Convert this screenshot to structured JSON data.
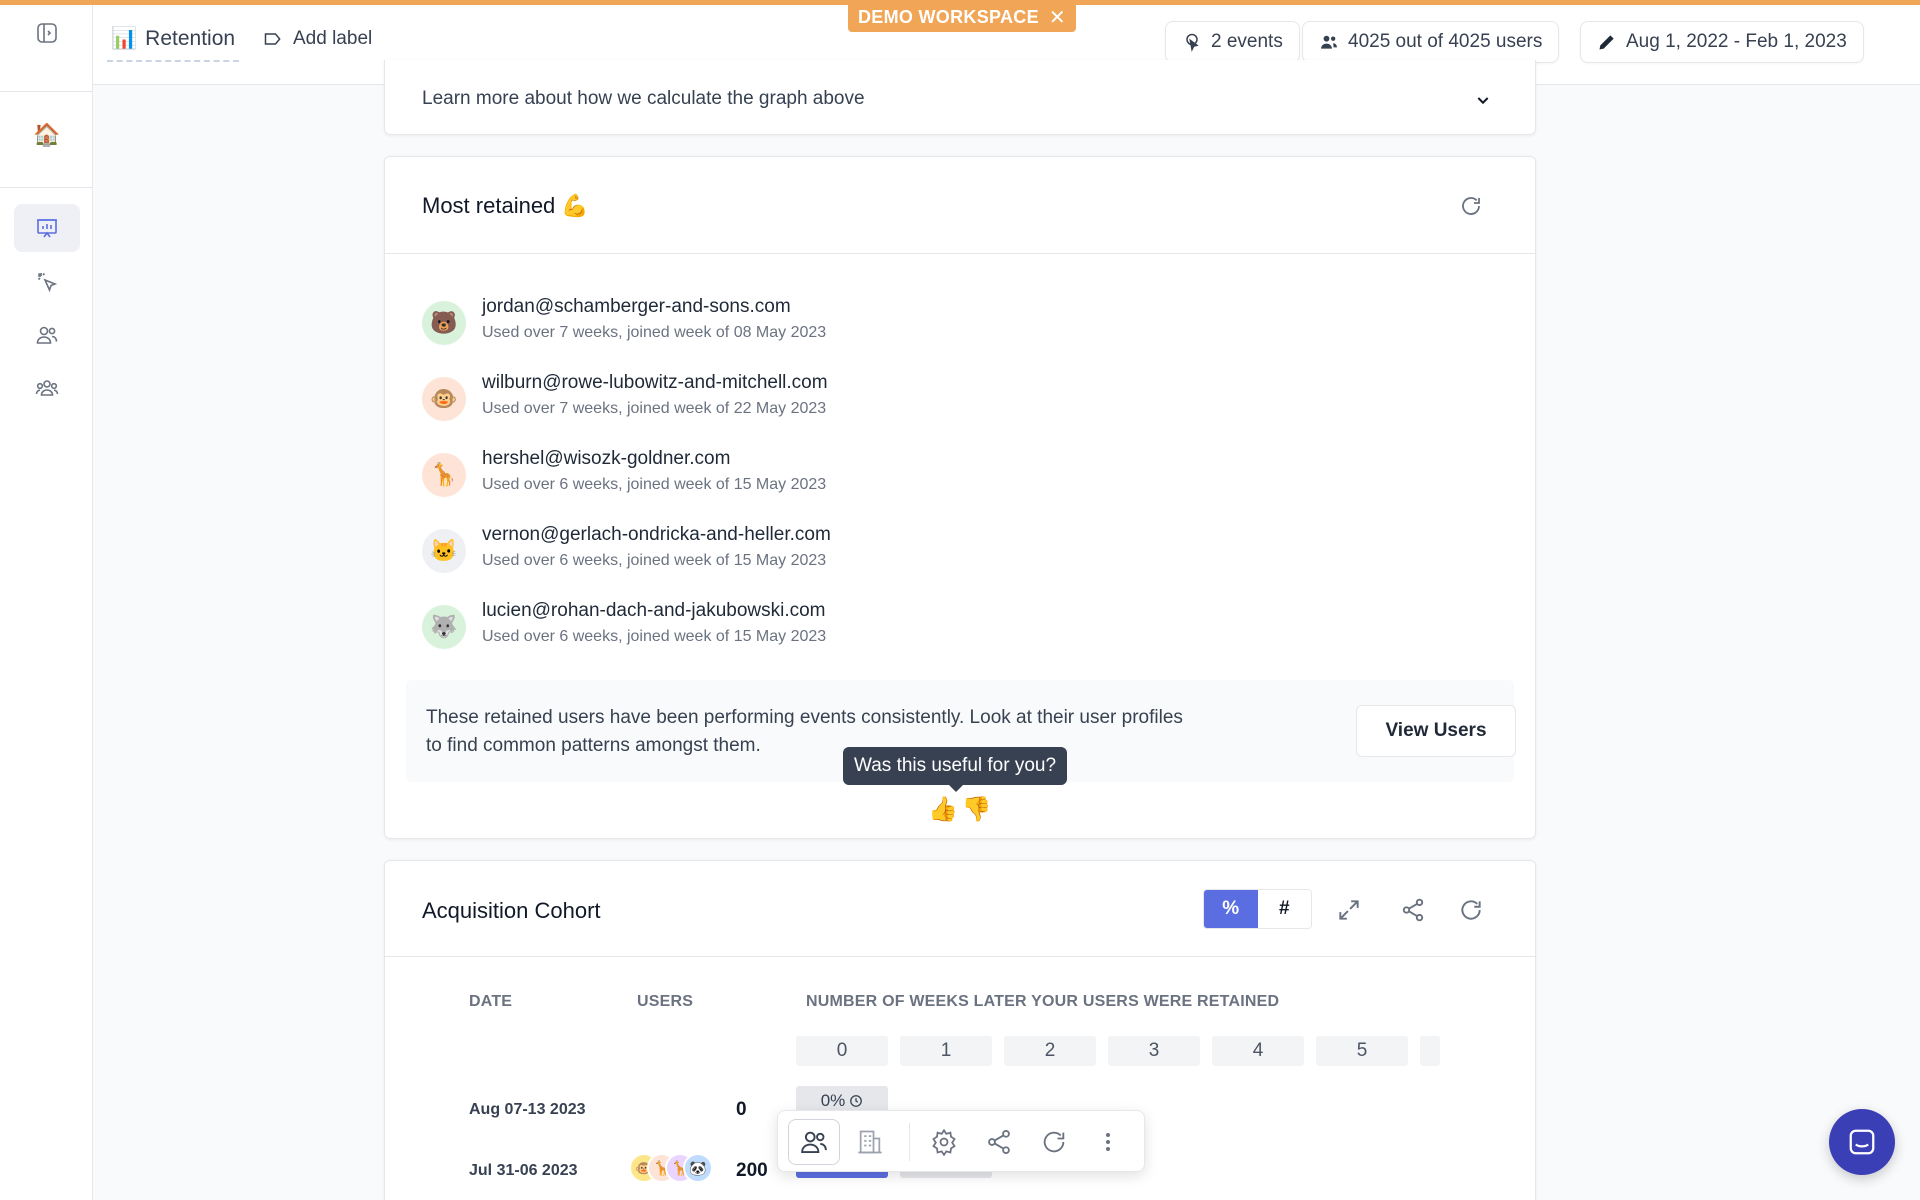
{
  "banner": {
    "label": "DEMO WORKSPACE",
    "close_symbol": "✕",
    "color": "#f0a656"
  },
  "sidebar": {
    "items": [
      {
        "name": "toggle-sidebar"
      },
      {
        "name": "home",
        "glyph": "🏠"
      },
      {
        "name": "reports",
        "active": true
      },
      {
        "name": "events"
      },
      {
        "name": "users"
      },
      {
        "name": "groups"
      }
    ]
  },
  "header": {
    "title_emoji": "📊",
    "title": "Retention",
    "add_label": "Add label",
    "events_btn": "2 events",
    "users_btn": "4025 out of 4025 users",
    "date_btn": "Aug 1, 2022 - Feb 1, 2023"
  },
  "learn_more": {
    "text": "Learn more about how we calculate the graph above"
  },
  "most_retained": {
    "title": "Most retained 💪",
    "users": [
      {
        "email": "jordan@schamberger-and-sons.com",
        "meta": "Used over 7 weeks, joined week of 08 May 2023",
        "avatar": "🐻",
        "bg": "#d9f2dc"
      },
      {
        "email": "wilburn@rowe-lubowitz-and-mitchell.com",
        "meta": "Used over 7 weeks, joined week of 22 May 2023",
        "avatar": "🐵",
        "bg": "#fde4d7"
      },
      {
        "email": "hershel@wisozk-goldner.com",
        "meta": "Used over 6 weeks, joined week of 15 May 2023",
        "avatar": "🦒",
        "bg": "#fde4d7"
      },
      {
        "email": "vernon@gerlach-ondricka-and-heller.com",
        "meta": "Used over 6 weeks, joined week of 15 May 2023",
        "avatar": "🐱",
        "bg": "#eef0f3"
      },
      {
        "email": "lucien@rohan-dach-and-jakubowski.com",
        "meta": "Used over 6 weeks, joined week of 15 May 2023",
        "avatar": "🐺",
        "bg": "#d9f2dc"
      }
    ],
    "insight": "These retained users have been performing events consistently. Look at their user profiles to find common patterns amongst them.",
    "view_users": "View Users",
    "tooltip": "Was this useful for you?",
    "thumbs_up": "👍",
    "thumbs_down": "👎"
  },
  "cohort": {
    "title": "Acquisition Cohort",
    "toggle_pct": "%",
    "toggle_num": "#",
    "col_date": "DATE",
    "col_users": "USERS",
    "col_weeks": "NUMBER OF WEEKS LATER YOUR USERS WERE RETAINED",
    "weeks": [
      "0",
      "1",
      "2",
      "3",
      "4",
      "5"
    ],
    "rows": [
      {
        "date": "Aug 07-13 2023",
        "users": "0",
        "first_cell": "0%"
      },
      {
        "date": "Jul 31-06 2023",
        "users": "200",
        "first_cell": ""
      }
    ],
    "accent": "#5b6ee1"
  }
}
